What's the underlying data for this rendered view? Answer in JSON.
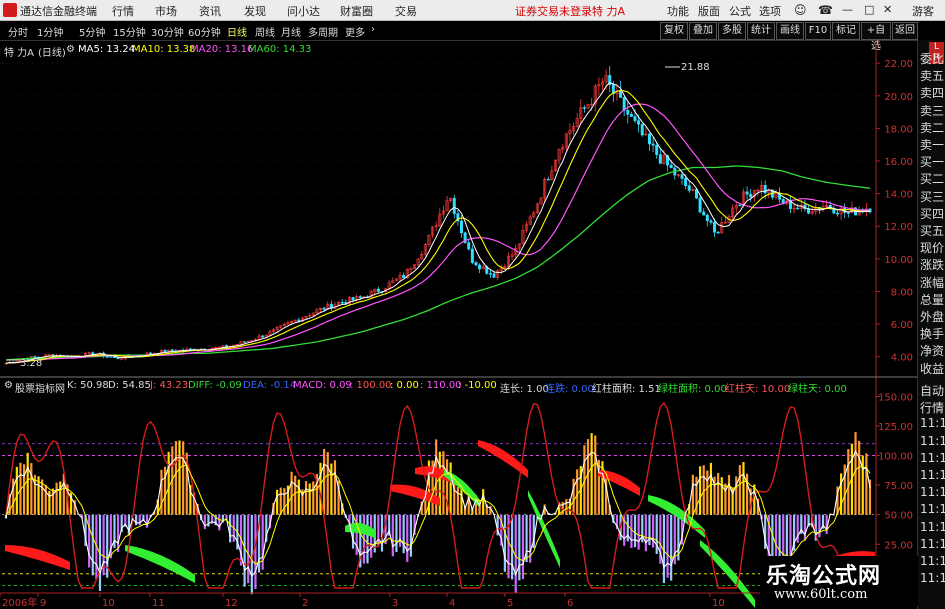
{
  "app": {
    "title": "通达信金融终端",
    "menu": [
      "行情",
      "市场",
      "资讯",
      "发现",
      "问小达",
      "财富圈",
      "交易"
    ],
    "login_status": "证券交易未登录",
    "stock_name": "特 力A",
    "right_menu": [
      "功能",
      "版面",
      "公式",
      "选项"
    ],
    "guest": "游客"
  },
  "toolbar": {
    "periods": [
      "分时",
      "1分钟",
      "5分钟",
      "15分钟",
      "30分钟",
      "60分钟",
      "日线",
      "周线",
      "月线",
      "多周期",
      "更多"
    ],
    "active_period": "日线",
    "right_buttons": [
      "复权",
      "叠加",
      "多股",
      "统计",
      "画线",
      "F10",
      "标记",
      "+自选",
      "返回"
    ]
  },
  "legend_main": {
    "stock": "特 力A",
    "cycle": "(日线)",
    "ma5": "MA5: 13.24",
    "ma10": "MA10: 13.38",
    "ma20": "MA20: 13.16",
    "ma60": "MA60: 14.33"
  },
  "legend_sub": {
    "indicator": "股票指标网",
    "items": [
      "K: 50.98",
      "D: 54.85",
      "J: 43.23",
      "DIFF: -0.09",
      "DEA: -0.14",
      "MACD: 0.09",
      ": 100.00",
      ": 0.00",
      ": 110.00",
      ": -10.00",
      "连长: 1.00",
      "连跌: 0.00",
      "红柱面积: 1.51",
      "绿柱面积: 0.00",
      "红柱天: 10.00",
      "绿柱天: 0.00"
    ]
  },
  "side_panel": {
    "items": [
      "委比",
      "卖五",
      "卖四",
      "卖三",
      "卖二",
      "卖一",
      "买一",
      "买二",
      "买三",
      "买四",
      "买五",
      "现价",
      "涨跌",
      "涨幅",
      "总量",
      "外盘",
      "换手",
      "净资",
      "收益"
    ],
    "lower_items": [
      "自动",
      "行情",
      "11:1",
      "11:1",
      "11:1",
      "11:1",
      "11:1",
      "11:1",
      "11:1",
      "11:1",
      "11:1",
      "11:1"
    ],
    "badge_top": "L",
    "badge_bottom": "R"
  },
  "price_axis": {
    "ticks": [
      "22.00",
      "20.00",
      "18.00",
      "16.00",
      "14.00",
      "12.00",
      "10.00",
      "8.00",
      "6.00",
      "4.00"
    ]
  },
  "indicator_axis": {
    "ticks": [
      "150.00",
      "125.00",
      "100.00",
      "75.00",
      "50.00",
      "25.00"
    ]
  },
  "time_axis": {
    "labels": [
      "2006年",
      "9",
      "10",
      "11",
      "12",
      "2",
      "3",
      "4",
      "5",
      "6",
      "10"
    ]
  },
  "annotations": {
    "high": "21.88",
    "low": "3.28"
  },
  "watermark": {
    "main": "乐淘公式网",
    "url": "www.60lt.com"
  },
  "colors": {
    "up": "#ff3b3b",
    "down": "#33ddff",
    "ma5": "#ffffff",
    "ma10": "#ffff00",
    "ma20": "#ff55ff",
    "ma60": "#33dd33"
  },
  "chart_data": {
    "type": "line",
    "price_ylim": [
      3,
      22.5
    ],
    "close_series_sampled": [
      3.6,
      3.9,
      4.1,
      4.0,
      4.2,
      3.9,
      4.1,
      4.3,
      4.4,
      4.5,
      4.6,
      5.0,
      5.5,
      6.2,
      6.8,
      7.3,
      7.6,
      8.2,
      9.0,
      11.0,
      14.0,
      10.0,
      9.0,
      10.5,
      13.5,
      17.0,
      19.0,
      21.0,
      19.0,
      17.0,
      15.5,
      14.0,
      11.5,
      13.5,
      14.5,
      13.5,
      13.0,
      13.3,
      12.8,
      13.2
    ],
    "ma60_sampled": [
      3.8,
      3.9,
      3.9,
      4.0,
      4.0,
      4.1,
      4.1,
      4.1,
      4.2,
      4.2,
      4.3,
      4.4,
      4.5,
      4.7,
      4.9,
      5.2,
      5.5,
      5.9,
      6.3,
      6.8,
      7.4,
      7.9,
      8.3,
      8.8,
      9.5,
      10.5,
      11.6,
      12.8,
      13.9,
      14.8,
      15.3,
      15.6,
      15.6,
      15.7,
      15.6,
      15.4,
      15.0,
      14.7,
      14.5,
      14.33
    ],
    "high_value": 21.88,
    "low_value": 3.28
  }
}
